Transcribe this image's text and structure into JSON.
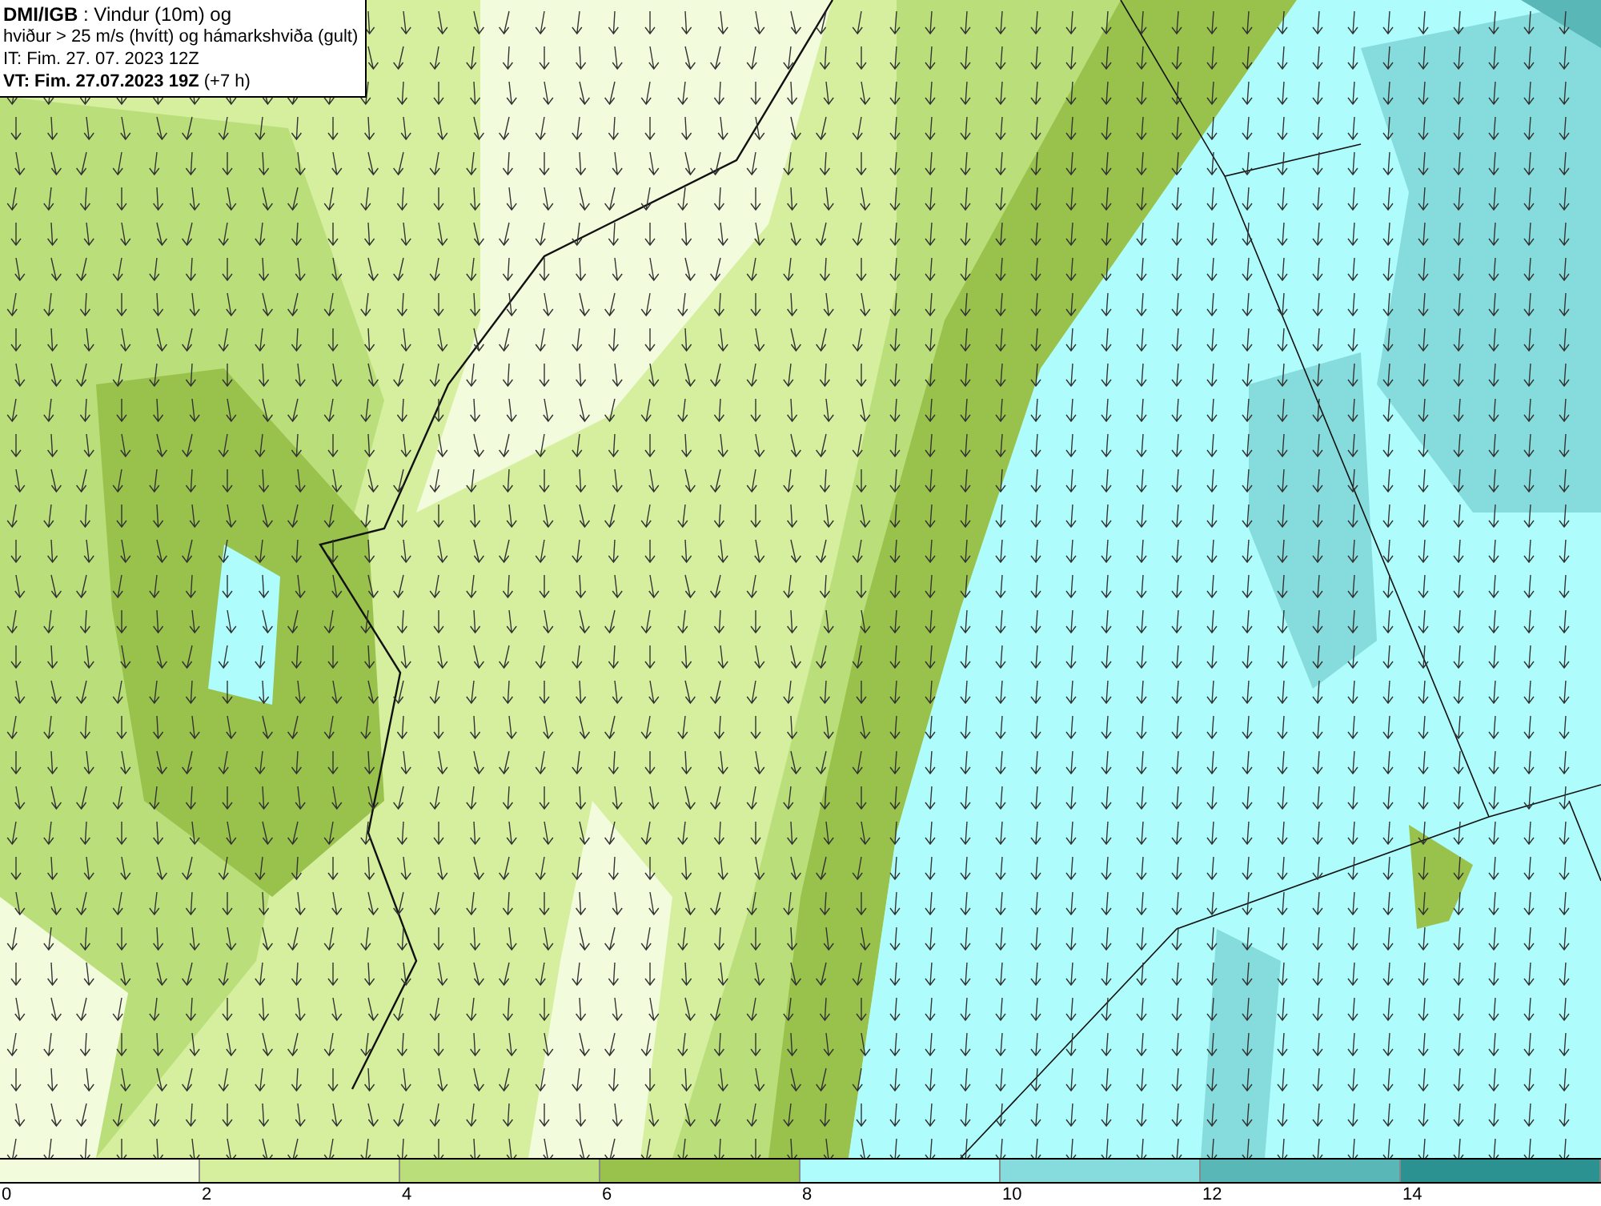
{
  "header": {
    "lines": [
      "**DMI/IGB** : Vindur (10m) og",
      "hviður > 25 m/s (hvítt) og hámarkshviða (gult)",
      "IT: Fim. 27. 07. 2023 12Z",
      "**VT: Fim. 27.07.2023 19Z** (+7 h)"
    ]
  },
  "legend": {
    "segments": [
      {
        "color": "#f3fbdd"
      },
      {
        "color": "#d5ef9f"
      },
      {
        "color": "#badf7a"
      },
      {
        "color": "#98c24b"
      },
      {
        "color": "#aefcfc"
      },
      {
        "color": "#86dcdc"
      },
      {
        "color": "#5ab7b7"
      },
      {
        "color": "#2b9191"
      }
    ],
    "ticks": [
      "0",
      "2",
      "4",
      "6",
      "8",
      "10",
      "12",
      "14"
    ]
  }
}
